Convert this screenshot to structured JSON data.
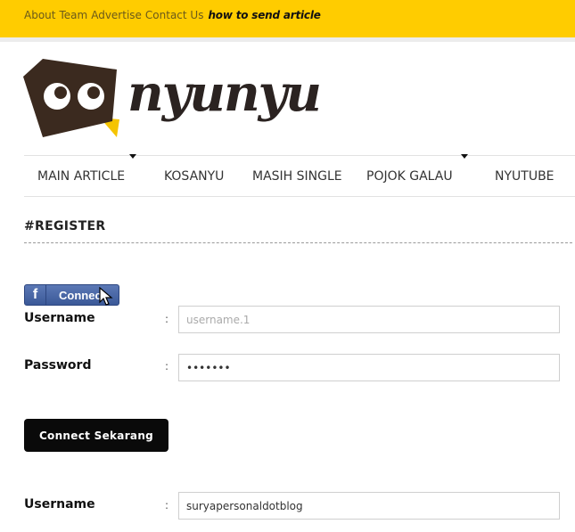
{
  "topnav": {
    "links": [
      "About",
      "Team",
      "Advertise",
      "Contact Us"
    ],
    "howto": "how to send article"
  },
  "brand": {
    "name": "nyunyu",
    "colors": {
      "topbar": "#ffcc00",
      "logo_dark": "#3b2a1f",
      "logo_beak": "#f5c400"
    }
  },
  "mainnav": {
    "items": [
      "MAIN ARTICLE",
      "KOSANYU",
      "MASIH SINGLE",
      "POJOK GALAU",
      "NYUTUBE"
    ]
  },
  "section": {
    "title": "#REGISTER"
  },
  "facebook": {
    "label": "Connect",
    "icon": "f"
  },
  "form": {
    "username_label": "Username",
    "username_placeholder": "username.1",
    "password_label": "Password",
    "password_value": "•••••••",
    "colon": ":",
    "submit_label": "Connect Sekarang",
    "username2_label": "Username",
    "username2_value": "suryapersonaldotblog"
  }
}
